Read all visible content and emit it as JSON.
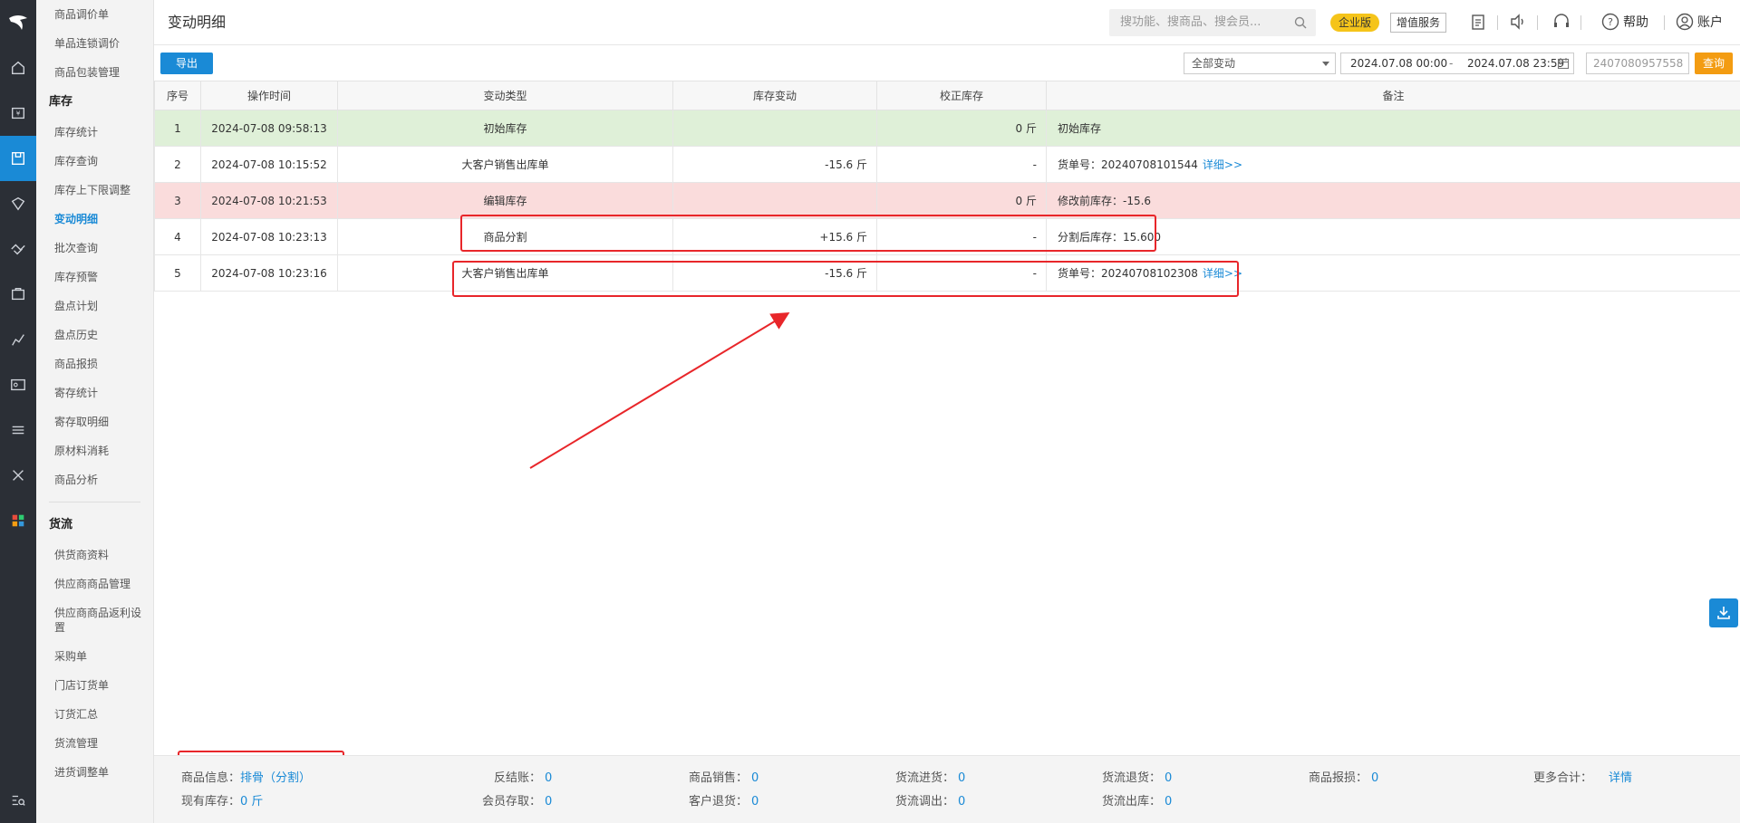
{
  "header": {
    "title": "变动明细",
    "search_placeholder": "搜功能、搜商品、搜会员...",
    "edition_badge": "企业版",
    "value_added": "增值服务",
    "help": "帮助",
    "account": "账户"
  },
  "sidebar": {
    "top_items": [
      "商品调价单",
      "单品连锁调价",
      "商品包装管理"
    ],
    "inventory_section": "库存",
    "inventory_items": [
      "库存统计",
      "库存查询",
      "库存上下限调整",
      "变动明细",
      "批次查询",
      "库存预警",
      "盘点计划",
      "盘点历史",
      "商品报损",
      "寄存统计",
      "寄存取明细",
      "原材料消耗",
      "商品分析"
    ],
    "logistics_section": "货流",
    "logistics_items": [
      "供货商资料",
      "供应商商品管理",
      "供应商商品返利设置",
      "采购单",
      "门店订货单",
      "订货汇总",
      "货流管理",
      "进货调整单"
    ]
  },
  "toolbar": {
    "export": "导出",
    "change_type": "全部变动",
    "date_start": "2024.07.08 00:00",
    "date_sep": "-",
    "date_end": "2024.07.08 23:59",
    "order_placeholder": "2407080957558",
    "query": "查询"
  },
  "table": {
    "columns": [
      "序号",
      "操作时间",
      "变动类型",
      "库存变动",
      "校正库存",
      "备注"
    ],
    "rows": [
      {
        "no": "1",
        "time": "2024-07-08 09:58:13",
        "type": "初始库存",
        "change": "",
        "corrected": "0 斤",
        "note": "初始库存",
        "link": ""
      },
      {
        "no": "2",
        "time": "2024-07-08 10:15:52",
        "type": "大客户销售出库单",
        "change": "-15.6 斤",
        "corrected": "-",
        "note": "货单号：20240708101544",
        "link": "详细>>"
      },
      {
        "no": "3",
        "time": "2024-07-08 10:21:53",
        "type": "编辑库存",
        "change": "",
        "corrected": "0 斤",
        "note": "修改前库存：-15.6",
        "link": ""
      },
      {
        "no": "4",
        "time": "2024-07-08 10:23:13",
        "type": "商品分割",
        "change": "+15.6 斤",
        "corrected": "-",
        "note": "分割后库存：15.600",
        "link": ""
      },
      {
        "no": "5",
        "time": "2024-07-08 10:23:16",
        "type": "大客户销售出库单",
        "change": "-15.6 斤",
        "corrected": "-",
        "note": "货单号：20240708102308",
        "link": "详细>>"
      }
    ]
  },
  "footer": {
    "product_info_label": "商品信息：",
    "product_info_value": "排骨（分割）",
    "current_stock_label": "现有库存：",
    "current_stock_value": "0 斤",
    "reverse_label": "反结账：",
    "reverse_value": "0",
    "member_label": "会员存取：",
    "member_value": "0",
    "sales_label": "商品销售：",
    "sales_value": "0",
    "return_label": "客户退货：",
    "return_value": "0",
    "flow_in_label": "货流进货：",
    "flow_in_value": "0",
    "flow_transfer_label": "货流调出：",
    "flow_transfer_value": "0",
    "flow_return_label": "货流退货：",
    "flow_return_value": "0",
    "flow_out_label": "货流出库：",
    "flow_out_value": "0",
    "damage_label": "商品报损：",
    "damage_value": "0",
    "more_label": "更多合计：",
    "more_value": "详情"
  },
  "colors": {
    "accent": "#1a8ad6",
    "highlight_green": "#dff0d8",
    "highlight_pink": "#fadcdc",
    "annotation_red": "#e8262a",
    "badge_yellow": "#f5c41a",
    "query_orange": "#f39c12"
  }
}
